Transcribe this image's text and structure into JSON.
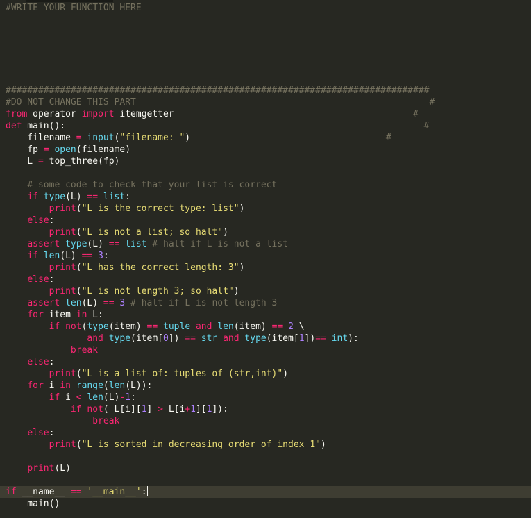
{
  "editor": {
    "language": "python",
    "lines": [
      [
        [
          "c",
          "#WRITE YOUR FUNCTION HERE"
        ]
      ],
      [],
      [],
      [],
      [],
      [],
      [],
      [
        [
          "c",
          "##############################################################################"
        ]
      ],
      [
        [
          "c",
          "#DO NOT CHANGE THIS PART                                                      #"
        ]
      ],
      [
        [
          "k",
          "from"
        ],
        [
          "t",
          " operator "
        ],
        [
          "k",
          "import"
        ],
        [
          "t",
          " itemgetter                                            "
        ],
        [
          "c",
          "#"
        ]
      ],
      [
        [
          "k",
          "def"
        ],
        [
          "t",
          " main():                                                                  "
        ],
        [
          "c",
          "#"
        ]
      ],
      [
        [
          "t",
          "    filename "
        ],
        [
          "o",
          "="
        ],
        [
          "t",
          " "
        ],
        [
          "b",
          "input"
        ],
        [
          "t",
          "("
        ],
        [
          "s",
          "\"filename: \""
        ],
        [
          "t",
          ")                                    "
        ],
        [
          "c",
          "#"
        ]
      ],
      [
        [
          "t",
          "    fp "
        ],
        [
          "o",
          "="
        ],
        [
          "t",
          " "
        ],
        [
          "b",
          "open"
        ],
        [
          "t",
          "(filename)"
        ]
      ],
      [
        [
          "t",
          "    L "
        ],
        [
          "o",
          "="
        ],
        [
          "t",
          " top_three(fp)"
        ]
      ],
      [],
      [
        [
          "t",
          "    "
        ],
        [
          "c",
          "# some code to check that your list is correct"
        ]
      ],
      [
        [
          "t",
          "    "
        ],
        [
          "k",
          "if"
        ],
        [
          "t",
          " "
        ],
        [
          "b",
          "type"
        ],
        [
          "t",
          "(L) "
        ],
        [
          "o",
          "=="
        ],
        [
          "t",
          " "
        ],
        [
          "b",
          "list"
        ],
        [
          "t",
          ":"
        ]
      ],
      [
        [
          "t",
          "        "
        ],
        [
          "k",
          "print"
        ],
        [
          "t",
          "("
        ],
        [
          "s",
          "\"L is the correct type: list\""
        ],
        [
          "t",
          ")"
        ]
      ],
      [
        [
          "t",
          "    "
        ],
        [
          "k",
          "else"
        ],
        [
          "t",
          ":"
        ]
      ],
      [
        [
          "t",
          "        "
        ],
        [
          "k",
          "print"
        ],
        [
          "t",
          "("
        ],
        [
          "s",
          "\"L is not a list; so halt\""
        ],
        [
          "t",
          ")"
        ]
      ],
      [
        [
          "t",
          "    "
        ],
        [
          "k",
          "assert"
        ],
        [
          "t",
          " "
        ],
        [
          "b",
          "type"
        ],
        [
          "t",
          "(L) "
        ],
        [
          "o",
          "=="
        ],
        [
          "t",
          " "
        ],
        [
          "b",
          "list"
        ],
        [
          "t",
          " "
        ],
        [
          "c",
          "# halt if L is not a list"
        ]
      ],
      [
        [
          "t",
          "    "
        ],
        [
          "k",
          "if"
        ],
        [
          "t",
          " "
        ],
        [
          "b",
          "len"
        ],
        [
          "t",
          "(L) "
        ],
        [
          "o",
          "=="
        ],
        [
          "t",
          " "
        ],
        [
          "n",
          "3"
        ],
        [
          "t",
          ":"
        ]
      ],
      [
        [
          "t",
          "        "
        ],
        [
          "k",
          "print"
        ],
        [
          "t",
          "("
        ],
        [
          "s",
          "\"L has the correct length: 3\""
        ],
        [
          "t",
          ")"
        ]
      ],
      [
        [
          "t",
          "    "
        ],
        [
          "k",
          "else"
        ],
        [
          "t",
          ":"
        ]
      ],
      [
        [
          "t",
          "        "
        ],
        [
          "k",
          "print"
        ],
        [
          "t",
          "("
        ],
        [
          "s",
          "\"L is not length 3; so halt\""
        ],
        [
          "t",
          ")"
        ]
      ],
      [
        [
          "t",
          "    "
        ],
        [
          "k",
          "assert"
        ],
        [
          "t",
          " "
        ],
        [
          "b",
          "len"
        ],
        [
          "t",
          "(L) "
        ],
        [
          "o",
          "=="
        ],
        [
          "t",
          " "
        ],
        [
          "n",
          "3"
        ],
        [
          "t",
          " "
        ],
        [
          "c",
          "# halt if L is not length 3"
        ]
      ],
      [
        [
          "t",
          "    "
        ],
        [
          "k",
          "for"
        ],
        [
          "t",
          " item "
        ],
        [
          "k",
          "in"
        ],
        [
          "t",
          " L:"
        ]
      ],
      [
        [
          "t",
          "        "
        ],
        [
          "k",
          "if"
        ],
        [
          "t",
          " "
        ],
        [
          "k",
          "not"
        ],
        [
          "t",
          "("
        ],
        [
          "b",
          "type"
        ],
        [
          "t",
          "(item) "
        ],
        [
          "o",
          "=="
        ],
        [
          "t",
          " "
        ],
        [
          "b",
          "tuple"
        ],
        [
          "t",
          " "
        ],
        [
          "k",
          "and"
        ],
        [
          "t",
          " "
        ],
        [
          "b",
          "len"
        ],
        [
          "t",
          "(item) "
        ],
        [
          "o",
          "=="
        ],
        [
          "t",
          " "
        ],
        [
          "n",
          "2"
        ],
        [
          "t",
          " \\"
        ]
      ],
      [
        [
          "t",
          "               "
        ],
        [
          "k",
          "and"
        ],
        [
          "t",
          " "
        ],
        [
          "b",
          "type"
        ],
        [
          "t",
          "(item["
        ],
        [
          "n",
          "0"
        ],
        [
          "t",
          "]) "
        ],
        [
          "o",
          "=="
        ],
        [
          "t",
          " "
        ],
        [
          "b",
          "str"
        ],
        [
          "t",
          " "
        ],
        [
          "k",
          "and"
        ],
        [
          "t",
          " "
        ],
        [
          "b",
          "type"
        ],
        [
          "t",
          "(item["
        ],
        [
          "n",
          "1"
        ],
        [
          "t",
          "])"
        ],
        [
          "o",
          "=="
        ],
        [
          "t",
          " "
        ],
        [
          "b",
          "int"
        ],
        [
          "t",
          "):"
        ]
      ],
      [
        [
          "t",
          "            "
        ],
        [
          "k",
          "break"
        ]
      ],
      [
        [
          "t",
          "    "
        ],
        [
          "k",
          "else"
        ],
        [
          "t",
          ":"
        ]
      ],
      [
        [
          "t",
          "        "
        ],
        [
          "k",
          "print"
        ],
        [
          "t",
          "("
        ],
        [
          "s",
          "\"L is a list of: tuples of (str,int)\""
        ],
        [
          "t",
          ")"
        ]
      ],
      [
        [
          "t",
          "    "
        ],
        [
          "k",
          "for"
        ],
        [
          "t",
          " i "
        ],
        [
          "k",
          "in"
        ],
        [
          "t",
          " "
        ],
        [
          "b",
          "range"
        ],
        [
          "t",
          "("
        ],
        [
          "b",
          "len"
        ],
        [
          "t",
          "(L)):"
        ]
      ],
      [
        [
          "t",
          "        "
        ],
        [
          "k",
          "if"
        ],
        [
          "t",
          " i "
        ],
        [
          "o",
          "<"
        ],
        [
          "t",
          " "
        ],
        [
          "b",
          "len"
        ],
        [
          "t",
          "(L)"
        ],
        [
          "o",
          "-"
        ],
        [
          "n",
          "1"
        ],
        [
          "t",
          ":"
        ]
      ],
      [
        [
          "t",
          "            "
        ],
        [
          "k",
          "if"
        ],
        [
          "t",
          " "
        ],
        [
          "k",
          "not"
        ],
        [
          "t",
          "( L[i]["
        ],
        [
          "n",
          "1"
        ],
        [
          "t",
          "] "
        ],
        [
          "o",
          ">"
        ],
        [
          "t",
          " L[i"
        ],
        [
          "o",
          "+"
        ],
        [
          "n",
          "1"
        ],
        [
          "t",
          "]["
        ],
        [
          "n",
          "1"
        ],
        [
          "t",
          "]):"
        ]
      ],
      [
        [
          "t",
          "                "
        ],
        [
          "k",
          "break"
        ]
      ],
      [
        [
          "t",
          "    "
        ],
        [
          "k",
          "else"
        ],
        [
          "t",
          ":"
        ]
      ],
      [
        [
          "t",
          "        "
        ],
        [
          "k",
          "print"
        ],
        [
          "t",
          "("
        ],
        [
          "s",
          "\"L is sorted in decreasing order of index 1\""
        ],
        [
          "t",
          ")"
        ]
      ],
      [],
      [
        [
          "t",
          "    "
        ],
        [
          "k",
          "print"
        ],
        [
          "t",
          "(L)"
        ]
      ],
      [],
      [
        [
          "k",
          "if"
        ],
        [
          "t",
          " __name__ "
        ],
        [
          "o",
          "=="
        ],
        [
          "t",
          " "
        ],
        [
          "s",
          "'__main__'"
        ],
        [
          "t",
          ":"
        ]
      ],
      [
        [
          "t",
          "    main()"
        ]
      ]
    ],
    "current_line": 41,
    "colors": {
      "background": "#272822",
      "current_line": "#3e3d32",
      "comment": "#75715e",
      "keyword": "#f92672",
      "builtin": "#66d9ef",
      "string": "#e6db74",
      "number": "#ae81ff",
      "text": "#f8f8f2"
    }
  }
}
